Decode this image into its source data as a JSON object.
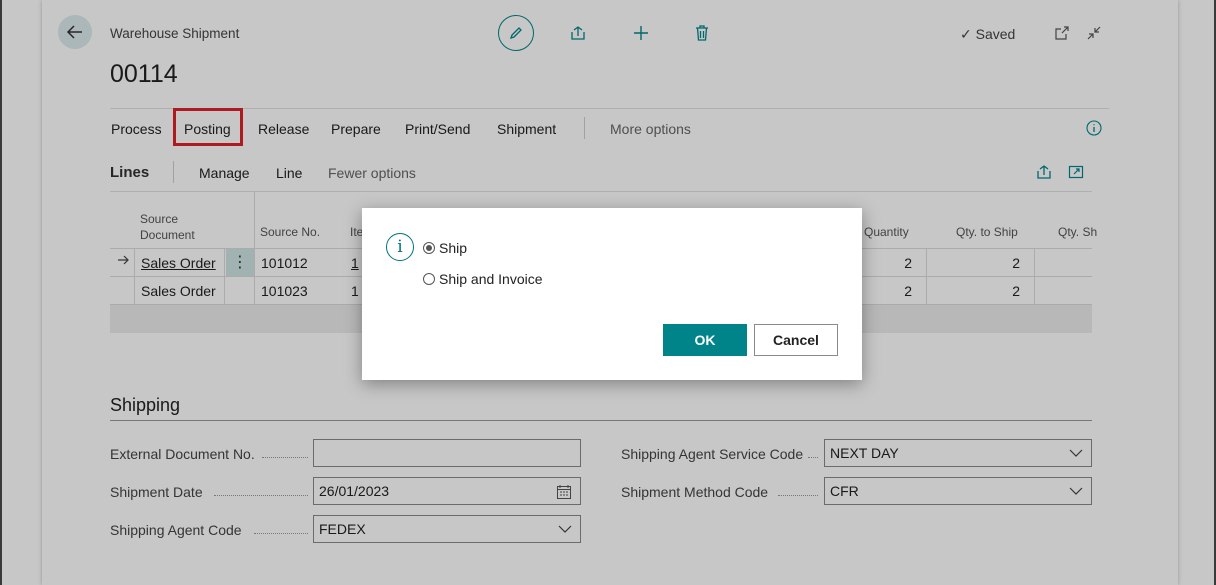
{
  "header": {
    "breadcrumb": "Warehouse Shipment",
    "document_no": "00114",
    "saved_label": "Saved"
  },
  "actions": [
    "Process",
    "Posting",
    "Release",
    "Prepare",
    "Print/Send",
    "Shipment"
  ],
  "more_options": "More options",
  "lines": {
    "title": "Lines",
    "actions": [
      "Manage",
      "Line"
    ],
    "fewer_options": "Fewer options",
    "columns": {
      "source_document": "Source Document",
      "source_no": "Source No.",
      "item": "Ite",
      "quantity": "Quantity",
      "qty_to_ship": "Qty. to Ship",
      "qty_shipped": "Qty. Sh"
    },
    "rows": [
      {
        "source_document": "Sales Order",
        "source_no": "101012",
        "item": "1",
        "quantity": "2",
        "qty_to_ship": "2"
      },
      {
        "source_document": "Sales Order",
        "source_no": "101023",
        "item": "1",
        "quantity": "2",
        "qty_to_ship": "2"
      }
    ]
  },
  "shipping": {
    "title": "Shipping",
    "external_doc_label": "External Document No.",
    "external_doc_value": "",
    "shipment_date_label": "Shipment Date",
    "shipment_date_value": "26/01/2023",
    "agent_code_label": "Shipping Agent Code",
    "agent_code_value": "FEDEX",
    "agent_service_label": "Shipping Agent Service Code",
    "agent_service_value": "NEXT DAY",
    "method_label": "Shipment Method Code",
    "method_value": "CFR"
  },
  "dialog": {
    "info_glyph": "i",
    "options": [
      "Ship",
      "Ship and Invoice"
    ],
    "selected_index": 0,
    "ok_label": "OK",
    "cancel_label": "Cancel"
  },
  "colors": {
    "accent": "#008489",
    "highlight": "#e0202a"
  }
}
